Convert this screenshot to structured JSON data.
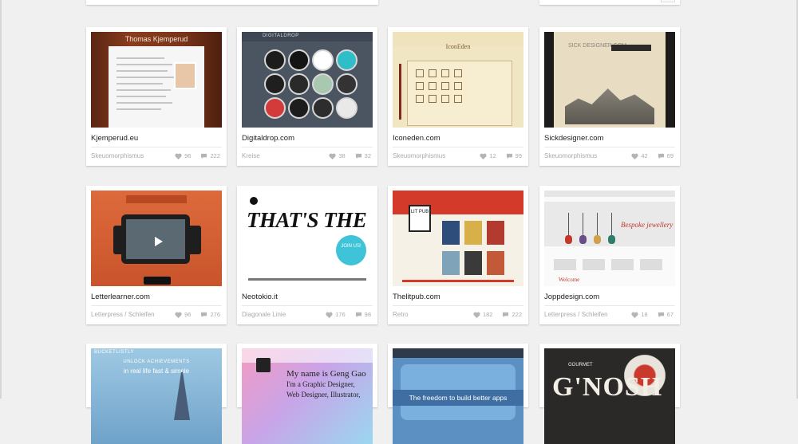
{
  "colors": {
    "page_background": "#f0f0f0",
    "card_background": "#ffffff",
    "title_text": "#222222",
    "meta_text": "#aaaaaa"
  },
  "icons": {
    "likes": "heart-icon",
    "comments": "comment-icon"
  },
  "cards": [
    {
      "title": "Kjemperud.eu",
      "category": "Skeuomorphismus",
      "likes": "96",
      "comments": "222",
      "thumb_text": "Thomas Kjemperud"
    },
    {
      "title": "Digitaldrop.com",
      "category": "Kreise",
      "likes": "38",
      "comments": "32",
      "thumb_text": "DIGITALDROP"
    },
    {
      "title": "Iconeden.com",
      "category": "Skeuomorphismus",
      "likes": "12",
      "comments": "99",
      "thumb_text": "IconEden"
    },
    {
      "title": "Sickdesigner.com",
      "category": "Skeuomorphismus",
      "likes": "42",
      "comments": "69",
      "thumb_text": "SICK DESIGNER.COM"
    },
    {
      "title": "Letterlearner.com",
      "category": "Letterpress / Schleifen",
      "likes": "96",
      "comments": "276",
      "thumb_text": ""
    },
    {
      "title": "Neotokio.it",
      "category": "Diagonale Linie",
      "likes": "176",
      "comments": "98",
      "thumb_text": "THAT'S THE WAY LIKE IT!",
      "thumb_badge": "JOIN US!"
    },
    {
      "title": "Thelitpub.com",
      "category": "Retro",
      "likes": "182",
      "comments": "222",
      "thumb_text": "LIT PUB"
    },
    {
      "title": "Joppdesign.com",
      "category": "Letterpress / Schleifen",
      "likes": "18",
      "comments": "67",
      "thumb_text": "Bespoke jewellery",
      "thumb_subtext": "Welcome"
    },
    {
      "title": "",
      "category": "",
      "likes": "",
      "comments": "",
      "thumb_text": "UNLOCK ACHIEVEMENTS",
      "thumb_subtext": "in real life fast & simple",
      "thumb_label": "BUCKETLISTLY"
    },
    {
      "title": "",
      "category": "",
      "likes": "",
      "comments": "",
      "thumb_text": "My name is Geng Gao",
      "thumb_subtext": "I'm a Graphic Designer, Web Designer, Illustrator,"
    },
    {
      "title": "",
      "category": "",
      "likes": "",
      "comments": "",
      "thumb_text": "The freedom to build better apps"
    },
    {
      "title": "",
      "category": "",
      "likes": "",
      "comments": "",
      "thumb_text": "G'NOSH",
      "thumb_subtext": "GOURMET"
    }
  ]
}
